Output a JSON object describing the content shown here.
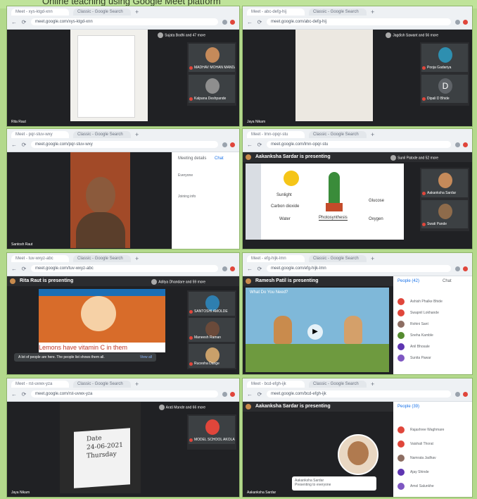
{
  "banner_text": "Online teaching using Google Meet platform",
  "colors": {
    "meet_bg": "#202124",
    "chrome_bg": "#eef1f4",
    "mic_off": "#e0463b",
    "frame_bg": "#b3d98c"
  },
  "panels": [
    {
      "tab1": "Meet - xys-ktgd-xnn",
      "tab2": "Classic - Google Search",
      "url": "meet.google.com/xys-ktgd-xnn",
      "names_top": "Sujata Bodhi and 47 more",
      "p1": "MADHAV MOHAN MANDAGEWAR BARMAN",
      "p2": "Kalpana Deshpande",
      "you": "Rita Raut"
    },
    {
      "tab1": "Meet - abc-defg-hij",
      "tab2": "Classic - Google Search",
      "url": "meet.google.com/abc-defg-hij",
      "names_top": "Jagdish Sawant and 56 more",
      "p1": "Pooja Gadariya",
      "p2": "Dipali D Bhide",
      "you": "Jaya Nikam",
      "d_letter": "D"
    },
    {
      "tab1": "Meet - pqr-stuv-wxy",
      "tab2": "Classic - Google Search",
      "url": "meet.google.com/pqr-stuv-wxy",
      "you": "Santosh Raut",
      "detail1": "Meeting details",
      "detail2": "Chat",
      "detail3": "Everyone",
      "detail4": "Joining info"
    },
    {
      "tab1": "Meet - lmn-opqr-stu",
      "tab2": "Classic - Google Search",
      "url": "meet.google.com/lmn-opqr-stu",
      "presenting": "Aakanksha Sardar is presenting",
      "names_top": "Sunil Patode and 52 more",
      "sunlight": "Sunlight",
      "co2": "Carbon dioxide",
      "water": "Water",
      "glucose": "Glucose",
      "oxygen": "Oxygen",
      "photo": "Photosynthesis",
      "p1": "Aakanksha Sardar",
      "p2": "Swati Pande"
    },
    {
      "tab1": "Meet - tuv-wxyz-abc",
      "tab2": "Classic - Google Search",
      "url": "meet.google.com/tuv-wxyz-abc",
      "presenting": "Rita Raut is presenting",
      "names_top": "Aditya Dhandare and 59 more",
      "subtitle": "Lemons have vitamin C in them",
      "toast": "A lot of people are here. The people list shows them all.",
      "toast_btn": "View all",
      "p1": "SANTOSHI AMOLDE",
      "p2": "Maneesh Raman",
      "p3": "Rucesha Dange"
    },
    {
      "tab1": "Meet - efg-hijk-lmn",
      "tab2": "Classic - Google Search",
      "url": "meet.google.com/efg-hijk-lmn",
      "presenting": "Ramesh Patil is presenting",
      "video_title": "What Do You Need?",
      "people_tab": "People (42)",
      "chat_tab": "Chat",
      "rows": [
        "Ashish Phalke Bhide",
        "Swapnil Lokhande",
        "Rohini Sant",
        "Sneha Kamble",
        "Anil Bhosale",
        "Sunita Pawar"
      ]
    },
    {
      "tab1": "Meet - rst-uvwx-yza",
      "tab2": "Classic - Google Search",
      "url": "meet.google.com/rst-uvwx-yza",
      "names_top": "Arati Mande and 66 more",
      "board1": "Date",
      "board2": "24-06-2021",
      "board3": "Thursday",
      "p1": "MODEL SCHOOL AKOLA",
      "you": "Jaya Nikam"
    },
    {
      "tab1": "Meet - bcd-efgh-ijk",
      "tab2": "Classic - Google Search",
      "url": "meet.google.com/bcd-efgh-ijk",
      "presenting": "Aakanksha Sardar is presenting",
      "card1": "Aakanksha Sardar",
      "card2": "Presenting to everyone",
      "you": "Aakanksha Sardar",
      "people_tab": "People (39)",
      "rows": [
        "Rajashree Waghmare",
        "Vaishali Thorat",
        "Namrata Jadhav",
        "Ajay Shinde",
        "Amol Salunkhe"
      ]
    }
  ]
}
